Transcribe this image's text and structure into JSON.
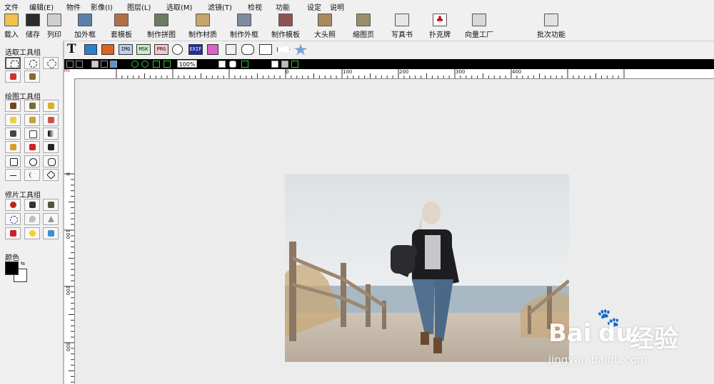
{
  "menubar": {
    "items": [
      "文件",
      "编辑(E)",
      "物件",
      "影像(I)",
      "图层(L)",
      "选取(M)",
      "滤镜(T)",
      "检视",
      "功能",
      "设定",
      "说明"
    ]
  },
  "toolbar": {
    "buttons": [
      {
        "label": "载入",
        "icon": "folder-open-icon"
      },
      {
        "label": "储存",
        "icon": "floppy-disk-icon"
      },
      {
        "label": "列印",
        "icon": "printer-icon"
      },
      {
        "label": "加外框",
        "icon": "add-frame-icon"
      },
      {
        "label": "套模板",
        "icon": "template-icon"
      },
      {
        "label": "制作拼图",
        "icon": "collage-icon"
      },
      {
        "label": "制作材质",
        "icon": "texture-icon"
      },
      {
        "label": "制作外框",
        "icon": "make-frame-icon"
      },
      {
        "label": "制作模板",
        "icon": "make-template-icon"
      },
      {
        "label": "大头照",
        "icon": "photo-sticker-icon"
      },
      {
        "label": "缩图页",
        "icon": "thumbnail-page-icon"
      },
      {
        "label": "写真书",
        "icon": "photo-book-icon"
      },
      {
        "label": "扑克牌",
        "icon": "poker-card-icon"
      },
      {
        "label": "向量工厂",
        "icon": "vector-factory-icon"
      },
      {
        "label": "批次功能",
        "icon": "batch-icon"
      }
    ]
  },
  "left_panel": {
    "select_group_title": "选取工具组",
    "draw_group_title": "绘图工具组",
    "retouch_group_title": "修片工具组",
    "color_title": "颜色"
  },
  "toolbar2": {
    "text_tool": "T",
    "labels": [
      "IMG",
      "MSK",
      "PRG",
      "EXIF"
    ]
  },
  "blackbar": {
    "zoom": "100%"
  },
  "ruler": {
    "h_labels": [
      "0",
      "100",
      "200",
      "300",
      "400"
    ],
    "v_labels": [
      "0",
      "100",
      "200",
      "300"
    ],
    "corner": "PIX"
  },
  "watermark": {
    "brand_a": "Bai",
    "brand_b": "du",
    "brand_c": "经验",
    "url": "jingyan.baidu.com"
  },
  "colors": {
    "accent_red": "#cc0000",
    "photo_sky": "#e8eaec",
    "photo_sea": "#a9b9c4"
  }
}
